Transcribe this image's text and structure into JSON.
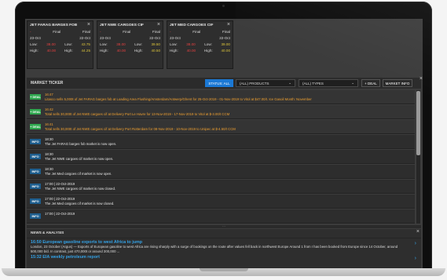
{
  "cards": [
    {
      "title": "JET FARAG BARGES FOB",
      "minus": "-",
      "col_label": "Final",
      "col_label2": "Final",
      "date1": "23-Oct",
      "date2": "22-Oct",
      "low_label": "Low:",
      "low1": "38.00",
      "low_label2": "Low:",
      "low2": "43.75",
      "high_label": "High:",
      "high1": "40.00",
      "high_label2": "High:",
      "high2": "44.25"
    },
    {
      "title": "JET NWE CARGOES CIF",
      "minus": "-",
      "col_label": "Final",
      "col_label2": "Final",
      "date1": "23-Oct",
      "date2": "22-Oct",
      "low_label": "Low:",
      "low1": "38.00",
      "low_label2": "Low:",
      "low2": "39.50",
      "high_label": "High:",
      "high1": "40.00",
      "high_label2": "High:",
      "high2": "40.50"
    },
    {
      "title": "JET MED CARGOES CIF",
      "minus": "-",
      "col_label": "Final",
      "col_label2": "Final",
      "date1": "23-Oct",
      "date2": "22-Oct",
      "low_label": "Low:",
      "low1": "38.00",
      "low_label2": "Low:",
      "low2": "39.00",
      "high_label": "High:",
      "high1": "40.00",
      "high_label2": "High:",
      "high2": "40.00"
    }
  ],
  "ticker": {
    "title": "MARKET TICKER",
    "status_label": "STATUS: ALL",
    "products_select": "(ALL) PRODUCTS",
    "types_select": "(ALL) TYPES",
    "deal_button": "+ DEAL",
    "market_info_button": "MARKET INFO",
    "close": "×",
    "rows": [
      {
        "badge": "+ DEAL",
        "time": "16:47",
        "msg": "Litasco sells 5,000t of Jet FARAG barges fob at Loading Area Flushing/Amsterdam/Antwerp/Ghent for 25-Oct-2019 - 01-Nov-2019 to Vitol at $47.00/t. Ice Gasoil Month: November"
      },
      {
        "badge": "+ DEAL",
        "time": "16:42",
        "msg": "Total sells 30,000t of Jet NWE cargoes cif at Delivery Port Le Havre for 13-Nov-2019 - 17-Nov-2019 to Vitol at $-3.00/t CCM"
      },
      {
        "badge": "+ DEAL",
        "time": "16:41",
        "msg": "Total sells 30,000t of Jet NWE cargoes cif at Delivery Port Rotterdam for 08-Nov-2019 - 10-Nov-2019 to Unipec at $-4.50/t CCM"
      },
      {
        "badge": "INFO",
        "time": "18:30",
        "msg": "The Jet FARAG barges fob market is now open."
      },
      {
        "badge": "INFO",
        "time": "18:30",
        "msg": "The Jet NWE cargoes cif market is now open."
      },
      {
        "badge": "INFO",
        "time": "18:30",
        "msg": "The Jet Med cargoes cif market is now open."
      },
      {
        "badge": "INFO",
        "time": "17:00 | 22-Oct-2019",
        "msg": "The Jet NWE cargoes cif market is now closed."
      },
      {
        "badge": "INFO",
        "time": "17:00 | 22-Oct-2019",
        "msg": "The Jet Med cargoes cif market is now closed."
      },
      {
        "badge": "INFO",
        "time": "17:00 | 22-Oct-2019",
        "msg": ""
      }
    ]
  },
  "news": {
    "title": "NEWS & ANALYSIS",
    "close": "×",
    "items": [
      {
        "title": "16:50 European gasoline exports to west Africa to jump",
        "text": "London, 23 October (Argus) — Exports of European gasoline to west Africa are rising sharply with a surge of bookings on the route after values fell back in northwest Europe Around 1 from I has been booked from Europe since 14 October, around 500,000 b/d. In contrast, just 470,000t or around 300,000 ..."
      },
      {
        "title": "15:32 EIA weekly petroleum report",
        "text": ""
      }
    ]
  },
  "colors": {
    "accent_blue": "#1b78d4",
    "deal_green": "#2fa84f",
    "deal_text": "#f0a030",
    "price_red": "#e24040",
    "price_yellow": "#d9c23b",
    "news_blue": "#34a2e6"
  }
}
